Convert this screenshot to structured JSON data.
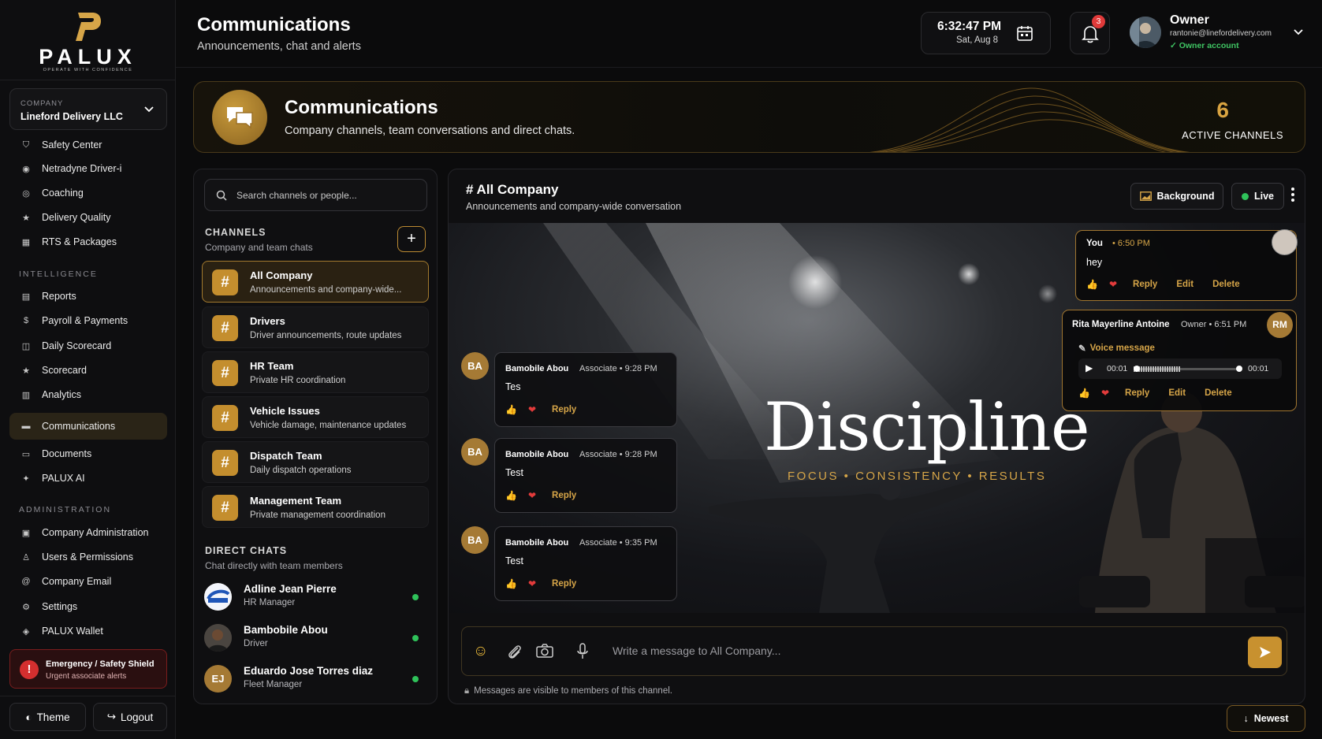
{
  "brand": {
    "name": "PALUX",
    "tagline": "OPERATE WITH CONFIDENCE"
  },
  "company": {
    "label": "COMPANY",
    "value": "Lineford Delivery LLC"
  },
  "nav": {
    "top": [
      {
        "label": "Safety Center",
        "icon": "shield-icon"
      },
      {
        "label": "Netradyne Driver-i",
        "icon": "camera-icon"
      },
      {
        "label": "Coaching",
        "icon": "target-icon"
      },
      {
        "label": "Delivery Quality",
        "icon": "star-icon"
      },
      {
        "label": "RTS & Packages",
        "icon": "package-icon"
      }
    ],
    "intelligence_heading": "INTELLIGENCE",
    "intelligence": [
      {
        "label": "Reports",
        "icon": "report-icon"
      },
      {
        "label": "Payroll & Payments",
        "icon": "dollar-icon"
      },
      {
        "label": "Daily Scorecard",
        "icon": "scorecard-icon"
      },
      {
        "label": "Scorecard",
        "icon": "star-icon"
      },
      {
        "label": "Analytics",
        "icon": "chart-icon"
      },
      {
        "label": "Communications",
        "icon": "chat-icon"
      },
      {
        "label": "Documents",
        "icon": "document-icon"
      },
      {
        "label": "PALUX AI",
        "icon": "sparkle-icon"
      }
    ],
    "administration_heading": "ADMINISTRATION",
    "administration": [
      {
        "label": "Company Administration",
        "icon": "building-icon"
      },
      {
        "label": "Users & Permissions",
        "icon": "users-icon"
      },
      {
        "label": "Company Email",
        "icon": "at-icon"
      },
      {
        "label": "Settings",
        "icon": "gear-icon"
      },
      {
        "label": "PALUX Wallet",
        "icon": "wallet-icon"
      }
    ]
  },
  "emergency": {
    "title": "Emergency / Safety Shield",
    "subtitle": "Urgent associate alerts"
  },
  "bottom": {
    "theme": "Theme",
    "logout": "Logout"
  },
  "header": {
    "title": "Communications",
    "subtitle": "Announcements, chat and alerts"
  },
  "clock": {
    "time": "6:32:47 PM",
    "date": "Sat, Aug 8"
  },
  "notifications": {
    "count": "3"
  },
  "user": {
    "name": "Owner",
    "email": "rantonie@linefordelivery.com",
    "account": "✓ Owner account"
  },
  "banner": {
    "title": "Communications",
    "subtitle": "Company channels, team conversations and direct chats.",
    "count": "6",
    "count_label": "ACTIVE CHANNELS"
  },
  "search": {
    "placeholder": "Search channels or people..."
  },
  "channels": {
    "heading": "CHANNELS",
    "subheading": "Company and team chats",
    "items": [
      {
        "name": "All Company",
        "desc": "Announcements and company-wide..."
      },
      {
        "name": "Drivers",
        "desc": "Driver announcements, route updates"
      },
      {
        "name": "HR Team",
        "desc": "Private HR coordination"
      },
      {
        "name": "Vehicle Issues",
        "desc": "Vehicle damage, maintenance updates"
      },
      {
        "name": "Dispatch Team",
        "desc": "Daily dispatch operations"
      },
      {
        "name": "Management Team",
        "desc": "Private management coordination"
      }
    ]
  },
  "direct": {
    "heading": "DIRECT CHATS",
    "subheading": "Chat directly with team members",
    "items": [
      {
        "name": "Adline Jean Pierre",
        "role": "HR Manager"
      },
      {
        "name": "Bambobile Abou",
        "role": "Driver"
      },
      {
        "name": "Eduardo Jose Torres diaz",
        "role": "Fleet Manager",
        "initials": "EJ"
      }
    ]
  },
  "chat": {
    "title": "# All Company",
    "subtitle": "Announcements and company-wide conversation",
    "background_btn": "Background",
    "live_btn": "Live",
    "hero": {
      "word": "Discipline",
      "tagline": "FOCUS • CONSISTENCY • RESULTS"
    },
    "messages": [
      {
        "initials": "BA",
        "author": "Bamobile Abou",
        "meta": "Associate • 9:28 PM",
        "text": "Tes",
        "reply": "Reply"
      },
      {
        "initials": "BA",
        "author": "Bamobile Abou",
        "meta": "Associate • 9:28 PM",
        "text": "Test",
        "reply": "Reply"
      },
      {
        "initials": "BA",
        "author": "Bamobile Abou",
        "meta": "Associate • 9:35 PM",
        "text": "Test",
        "reply": "Reply"
      }
    ],
    "own": {
      "author": "You",
      "meta": "• 6:50 PM",
      "text": "hey",
      "reply": "Reply",
      "edit": "Edit",
      "delete": "Delete"
    },
    "voice": {
      "author": "Rita Mayerline Antoine",
      "meta": "Owner • 6:51 PM",
      "initials": "RM",
      "label": "Voice message",
      "start": "00:01",
      "end": "00:01",
      "progress": 0.0,
      "reply": "Reply",
      "edit": "Edit",
      "delete": "Delete"
    },
    "composer_placeholder": "Write a message to All Company...",
    "note": "Messages are visible to members of this channel.",
    "newest": "Newest"
  },
  "colors": {
    "accent": "#c8912f",
    "online": "#2fc25a",
    "danger": "#d42f2f"
  }
}
